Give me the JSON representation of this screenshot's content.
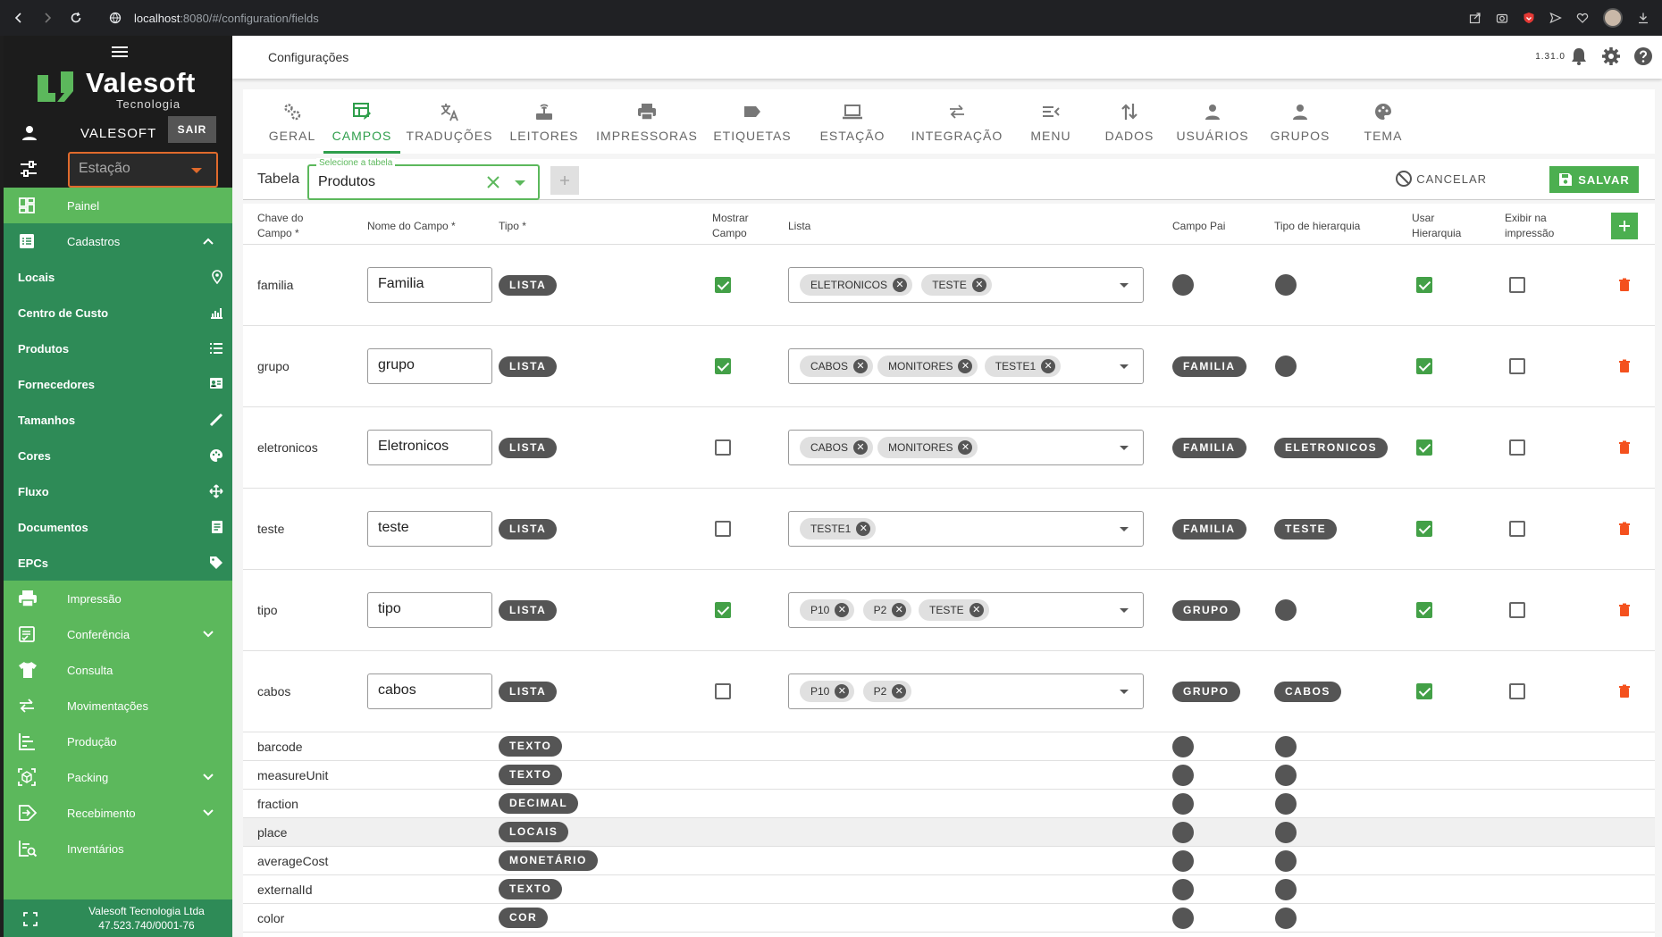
{
  "browser": {
    "url_host": "localhost",
    "url_path": ":8080/#/configuration/fields"
  },
  "sidebar": {
    "brand": "Valesoft",
    "brand_sub": "Tecnologia",
    "user": "VALESOFT",
    "logout": "SAIR",
    "station_placeholder": "Estação",
    "items": [
      {
        "label": "Painel",
        "icon": "dashboard-icon"
      },
      {
        "label": "Cadastros",
        "icon": "list-alt-icon"
      },
      {
        "label": "Locais",
        "icon": "location-pin-icon"
      },
      {
        "label": "Centro de Custo",
        "icon": "chart-icon"
      },
      {
        "label": "Produtos",
        "icon": "list-icon"
      },
      {
        "label": "Fornecedores",
        "icon": "id-card-icon"
      },
      {
        "label": "Tamanhos",
        "icon": "ruler-icon"
      },
      {
        "label": "Cores",
        "icon": "palette-icon"
      },
      {
        "label": "Fluxo",
        "icon": "move-icon"
      },
      {
        "label": "Documentos",
        "icon": "document-icon"
      },
      {
        "label": "EPCs",
        "icon": "tag-icon"
      },
      {
        "label": "Impressão",
        "icon": "printer-icon"
      },
      {
        "label": "Conferência",
        "icon": "checklist-icon"
      },
      {
        "label": "Consulta",
        "icon": "shirt-icon"
      },
      {
        "label": "Movimentações",
        "icon": "swap-icon"
      },
      {
        "label": "Produção",
        "icon": "production-icon"
      },
      {
        "label": "Packing",
        "icon": "packing-icon"
      },
      {
        "label": "Recebimento",
        "icon": "receive-icon"
      },
      {
        "label": "Inventários",
        "icon": "inventory-icon"
      }
    ],
    "footer_company": "Valesoft Tecnologia Ltda",
    "footer_cnpj": "47.523.740/0001-76"
  },
  "topbar": {
    "title": "Configurações",
    "version": "1.31.0"
  },
  "tabs": [
    {
      "label": "GERAL",
      "icon": "gears-icon"
    },
    {
      "label": "CAMPOS",
      "icon": "table-edit-icon"
    },
    {
      "label": "TRADUÇÕES",
      "icon": "translate-icon"
    },
    {
      "label": "LEITORES",
      "icon": "router-icon"
    },
    {
      "label": "IMPRESSORAS",
      "icon": "printer-icon"
    },
    {
      "label": "ETIQUETAS",
      "icon": "label-icon"
    },
    {
      "label": "ESTAÇÃO",
      "icon": "laptop-icon"
    },
    {
      "label": "INTEGRAÇÃO",
      "icon": "swap-icon"
    },
    {
      "label": "MENU",
      "icon": "menu-open-icon"
    },
    {
      "label": "DADOS",
      "icon": "sort-icon"
    },
    {
      "label": "USUÁRIOS",
      "icon": "person-icon"
    },
    {
      "label": "GRUPOS",
      "icon": "group-icon"
    },
    {
      "label": "TEMA",
      "icon": "palette-icon"
    }
  ],
  "toolbar": {
    "table_label": "Tabela",
    "select_legend": "Selecione a tabela",
    "select_value": "Produtos",
    "cancel": "CANCELAR",
    "save": "SALVAR"
  },
  "columns": {
    "key": "Chave do Campo *",
    "name": "Nome do Campo *",
    "type": "Tipo *",
    "show": "Mostrar Campo",
    "list": "Lista",
    "parent": "Campo Pai",
    "hier_type": "Tipo de hierarquia",
    "use_hier": "Usar Hierarquia",
    "print": "Exibir na impressão"
  },
  "rows": [
    {
      "key": "familia",
      "name": "Familia",
      "type": "LISTA",
      "show": true,
      "list": [
        "ELETRONICOS",
        "TESTE"
      ],
      "parent": "",
      "hier": "",
      "use_hier": true,
      "print": false
    },
    {
      "key": "grupo",
      "name": "grupo",
      "type": "LISTA",
      "show": true,
      "list": [
        "CABOS",
        "MONITORES",
        "TESTE1"
      ],
      "parent": "FAMILIA",
      "hier": "",
      "use_hier": true,
      "print": false
    },
    {
      "key": "eletronicos",
      "name": "Eletronicos",
      "type": "LISTA",
      "show": false,
      "list": [
        "CABOS",
        "MONITORES"
      ],
      "parent": "FAMILIA",
      "hier": "ELETRONICOS",
      "use_hier": true,
      "print": false
    },
    {
      "key": "teste",
      "name": "teste",
      "type": "LISTA",
      "show": false,
      "list": [
        "TESTE1"
      ],
      "parent": "FAMILIA",
      "hier": "TESTE",
      "use_hier": true,
      "print": false
    },
    {
      "key": "tipo",
      "name": "tipo",
      "type": "LISTA",
      "show": true,
      "list": [
        "P10",
        "P2",
        "TESTE"
      ],
      "parent": "GRUPO",
      "hier": "",
      "use_hier": true,
      "print": false
    },
    {
      "key": "cabos",
      "name": "cabos",
      "type": "LISTA",
      "show": false,
      "list": [
        "P10",
        "P2"
      ],
      "parent": "GRUPO",
      "hier": "CABOS",
      "use_hier": true,
      "print": false
    }
  ],
  "system_rows": [
    {
      "key": "barcode",
      "type": "TEXTO"
    },
    {
      "key": "measureUnit",
      "type": "TEXTO"
    },
    {
      "key": "fraction",
      "type": "DECIMAL"
    },
    {
      "key": "place",
      "type": "LOCAIS"
    },
    {
      "key": "averageCost",
      "type": "MONETÁRIO"
    },
    {
      "key": "externalId",
      "type": "TEXTO"
    },
    {
      "key": "color",
      "type": "COR"
    }
  ],
  "colors": {
    "sidebar_green": "#5cb85c",
    "sidebar_dark_green": "#2e8b57",
    "accent": "#2e9e4b",
    "delete": "#f4511e",
    "chip": "#555555"
  }
}
